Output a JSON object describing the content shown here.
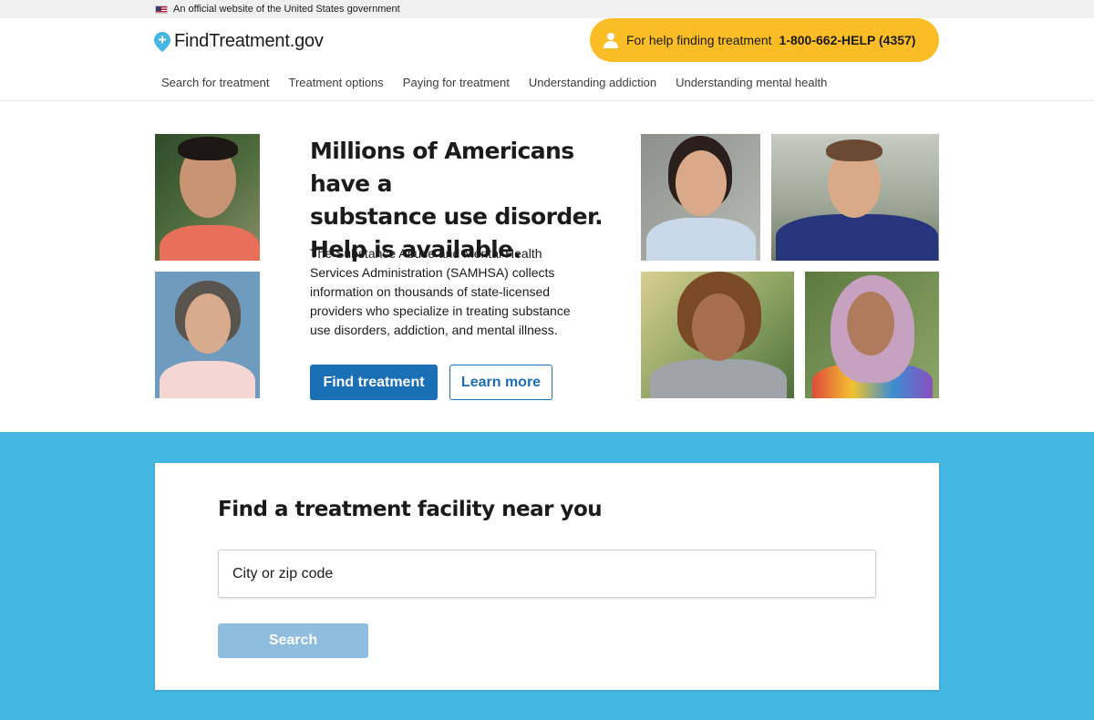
{
  "gov_banner": {
    "text": "An official website of the United States government"
  },
  "header": {
    "logo_text": "FindTreatment.gov",
    "helpline_prefix": "For help finding treatment",
    "helpline_number": "1-800-662-HELP (4357)"
  },
  "nav": {
    "items": [
      "Search for treatment",
      "Treatment options",
      "Paying for treatment",
      "Understanding addiction",
      "Understanding mental health"
    ]
  },
  "hero": {
    "title": "Millions of Americans have a\nsubstance use disorder.\nHelp is available.",
    "text": "The Substance Abuse and Mental Health Services Administration (SAMHSA) collects information on thousands of state-licensed providers who specialize in treating substance use disorders, addiction, and mental illness.",
    "primary_button": "Find treatment",
    "secondary_button": "Learn more"
  },
  "search": {
    "title": "Find a treatment facility near you",
    "placeholder": "City or zip code",
    "button": "Search"
  },
  "colors": {
    "accent_blue": "#1a6fb5",
    "helpline_yellow": "#fbbd26",
    "band_blue": "#45b7e3",
    "search_button_disabled": "#8fbde0"
  }
}
